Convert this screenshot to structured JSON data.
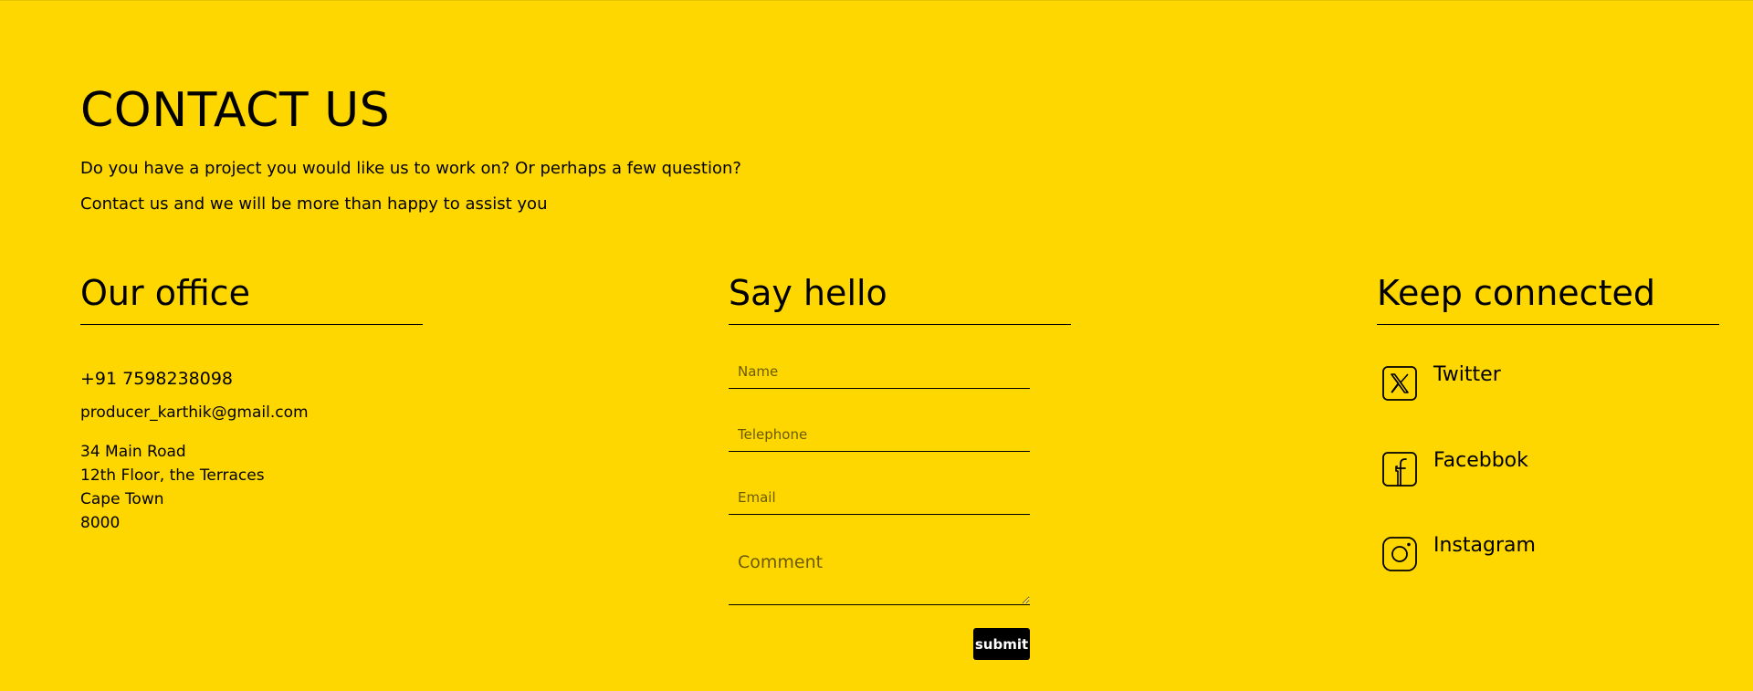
{
  "header": {
    "title": "CONTACT US",
    "intro_line_1": "Do you have a project you would like us to work on? Or perhaps a few question?",
    "intro_line_2": "Contact us and we will be more than happy to assist you"
  },
  "office": {
    "heading": "Our office",
    "phone": "+91 7598238098",
    "email": "producer_karthik@gmail.com",
    "address": [
      "34 Main Road",
      "12th Floor, the Terraces",
      "Cape Town",
      "8000"
    ]
  },
  "form": {
    "heading": "Say hello",
    "name_placeholder": "Name",
    "telephone_placeholder": "Telephone",
    "email_placeholder": "Email",
    "comment_placeholder": "Comment",
    "submit_label": "submit"
  },
  "social": {
    "heading": "Keep connected",
    "items": [
      {
        "label": "Twitter",
        "icon": "x-twitter-icon"
      },
      {
        "label": "Facebbok",
        "icon": "facebook-icon"
      },
      {
        "label": "Instagram",
        "icon": "instagram-icon"
      }
    ]
  },
  "colors": {
    "background": "#FFD700",
    "text": "#000000",
    "button": "#000000",
    "button_text": "#FFFFFF"
  }
}
